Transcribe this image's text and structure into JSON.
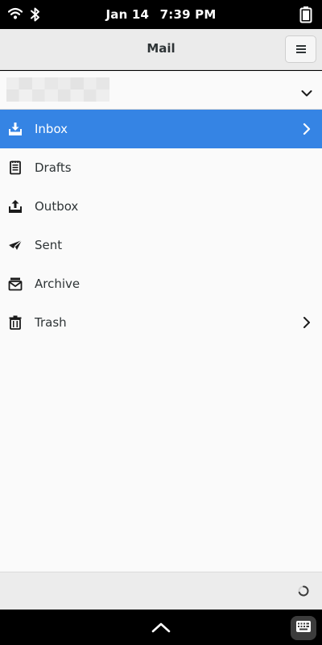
{
  "status_bar": {
    "date": "Jan 14",
    "time": "7:39 PM",
    "icons": [
      "wifi-icon",
      "bluetooth-icon",
      "battery-icon"
    ]
  },
  "header": {
    "title": "Mail",
    "menu_icon": "hamburger-menu-icon"
  },
  "account": {
    "name_redacted": true,
    "expand_icon": "chevron-down-icon"
  },
  "folders": [
    {
      "label": "Inbox",
      "icon": "inbox-download-icon",
      "selected": true,
      "has_children": true
    },
    {
      "label": "Drafts",
      "icon": "drafts-document-icon",
      "selected": false,
      "has_children": false
    },
    {
      "label": "Outbox",
      "icon": "outbox-upload-icon",
      "selected": false,
      "has_children": false
    },
    {
      "label": "Sent",
      "icon": "sent-paper-plane-icon",
      "selected": false,
      "has_children": false
    },
    {
      "label": "Archive",
      "icon": "archive-box-icon",
      "selected": false,
      "has_children": false
    },
    {
      "label": "Trash",
      "icon": "trash-can-icon",
      "selected": false,
      "has_children": true
    }
  ],
  "colors": {
    "accent": "#3584e4",
    "header_bg": "#ebebeb",
    "content_bg": "#fafafa",
    "text": "#2e3436"
  }
}
